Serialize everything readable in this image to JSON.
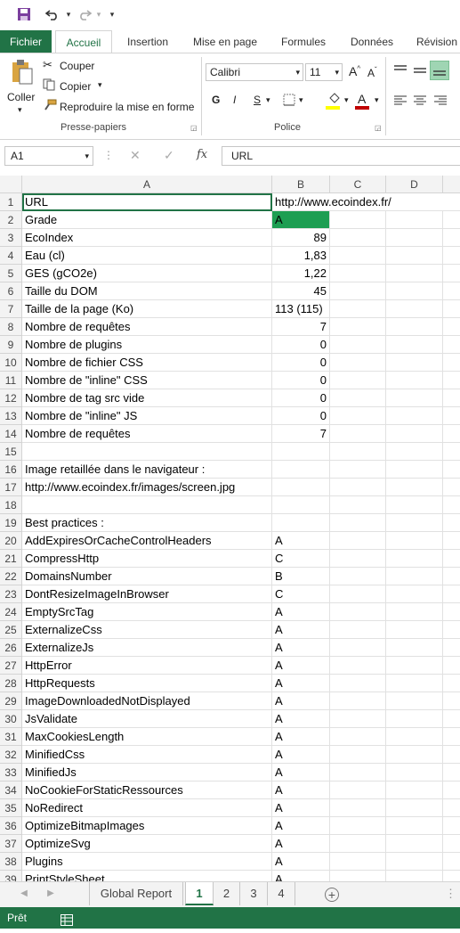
{
  "qat": {
    "save_icon": "save-icon",
    "undo_icon": "undo-icon",
    "redo_icon": "redo-icon",
    "customize_icon": "chevron-down-icon"
  },
  "tabs": [
    "Fichier",
    "Accueil",
    "Insertion",
    "Mise en page",
    "Formules",
    "Données",
    "Révision"
  ],
  "ribbon": {
    "paste_label": "Coller",
    "cut_label": "Couper",
    "copy_label": "Copier",
    "format_painter_label": "Reproduire la mise en forme",
    "clipboard_group": "Presse-papiers",
    "font_name": "Calibri",
    "font_size": "11",
    "grow_font": "A",
    "shrink_font": "A",
    "bold": "G",
    "italic": "I",
    "underline": "S",
    "font_color": "A",
    "font_group": "Police",
    "highlight_color": "#ffff00",
    "font_color_value": "#c00000"
  },
  "formula": {
    "namebox": "A1",
    "fx": "fx",
    "content": "URL"
  },
  "columns": [
    "A",
    "B",
    "C",
    "D"
  ],
  "rows": [
    {
      "n": "1",
      "a": "URL",
      "b": "http://www.ecoindex.fr/",
      "b_num": false
    },
    {
      "n": "2",
      "a": "Grade",
      "b": "A",
      "b_num": false,
      "b_fill": "#1d9e52"
    },
    {
      "n": "3",
      "a": "EcoIndex",
      "b": "89",
      "b_num": true
    },
    {
      "n": "4",
      "a": "Eau (cl)",
      "b": "1,83",
      "b_num": true
    },
    {
      "n": "5",
      "a": "GES (gCO2e)",
      "b": "1,22",
      "b_num": true
    },
    {
      "n": "6",
      "a": "Taille du DOM",
      "b": "45",
      "b_num": true
    },
    {
      "n": "7",
      "a": "Taille de la page (Ko)",
      "b": "113 (115)",
      "b_num": false
    },
    {
      "n": "8",
      "a": "Nombre de requêtes",
      "b": "7",
      "b_num": true
    },
    {
      "n": "9",
      "a": "Nombre de plugins",
      "b": "0",
      "b_num": true
    },
    {
      "n": "10",
      "a": "Nombre de fichier CSS",
      "b": "0",
      "b_num": true
    },
    {
      "n": "11",
      "a": "Nombre de \"inline\" CSS",
      "b": "0",
      "b_num": true
    },
    {
      "n": "12",
      "a": "Nombre de tag src vide",
      "b": "0",
      "b_num": true
    },
    {
      "n": "13",
      "a": "Nombre de \"inline\" JS",
      "b": "0",
      "b_num": true
    },
    {
      "n": "14",
      "a": "Nombre de requêtes",
      "b": "7",
      "b_num": true
    },
    {
      "n": "15",
      "a": "",
      "b": "",
      "b_num": false
    },
    {
      "n": "16",
      "a": "Image retaillée dans le navigateur :",
      "b": "",
      "b_num": false
    },
    {
      "n": "17",
      "a": "http://www.ecoindex.fr/images/screen.jpg",
      "b": "",
      "b_num": false
    },
    {
      "n": "18",
      "a": "",
      "b": "",
      "b_num": false
    },
    {
      "n": "19",
      "a": "Best practices :",
      "b": "",
      "b_num": false
    },
    {
      "n": "20",
      "a": "AddExpiresOrCacheControlHeaders",
      "b": "A",
      "b_num": false
    },
    {
      "n": "21",
      "a": "CompressHttp",
      "b": "C",
      "b_num": false
    },
    {
      "n": "22",
      "a": "DomainsNumber",
      "b": "B",
      "b_num": false
    },
    {
      "n": "23",
      "a": "DontResizeImageInBrowser",
      "b": "C",
      "b_num": false
    },
    {
      "n": "24",
      "a": "EmptySrcTag",
      "b": "A",
      "b_num": false
    },
    {
      "n": "25",
      "a": "ExternalizeCss",
      "b": "A",
      "b_num": false
    },
    {
      "n": "26",
      "a": "ExternalizeJs",
      "b": "A",
      "b_num": false
    },
    {
      "n": "27",
      "a": "HttpError",
      "b": "A",
      "b_num": false
    },
    {
      "n": "28",
      "a": "HttpRequests",
      "b": "A",
      "b_num": false
    },
    {
      "n": "29",
      "a": "ImageDownloadedNotDisplayed",
      "b": "A",
      "b_num": false
    },
    {
      "n": "30",
      "a": "JsValidate",
      "b": "A",
      "b_num": false
    },
    {
      "n": "31",
      "a": "MaxCookiesLength",
      "b": "A",
      "b_num": false
    },
    {
      "n": "32",
      "a": "MinifiedCss",
      "b": "A",
      "b_num": false
    },
    {
      "n": "33",
      "a": "MinifiedJs",
      "b": "A",
      "b_num": false
    },
    {
      "n": "34",
      "a": "NoCookieForStaticRessources",
      "b": "A",
      "b_num": false
    },
    {
      "n": "35",
      "a": "NoRedirect",
      "b": "A",
      "b_num": false
    },
    {
      "n": "36",
      "a": "OptimizeBitmapImages",
      "b": "A",
      "b_num": false
    },
    {
      "n": "37",
      "a": "OptimizeSvg",
      "b": "A",
      "b_num": false
    },
    {
      "n": "38",
      "a": "Plugins",
      "b": "A",
      "b_num": false
    },
    {
      "n": "39",
      "a": "PrintStyleSheet",
      "b": "A",
      "b_num": false
    }
  ],
  "sheet_tabs": [
    "Global Report",
    "1",
    "2",
    "3",
    "4"
  ],
  "active_sheet": "1",
  "status": {
    "ready": "Prêt"
  },
  "accent": "#217346"
}
